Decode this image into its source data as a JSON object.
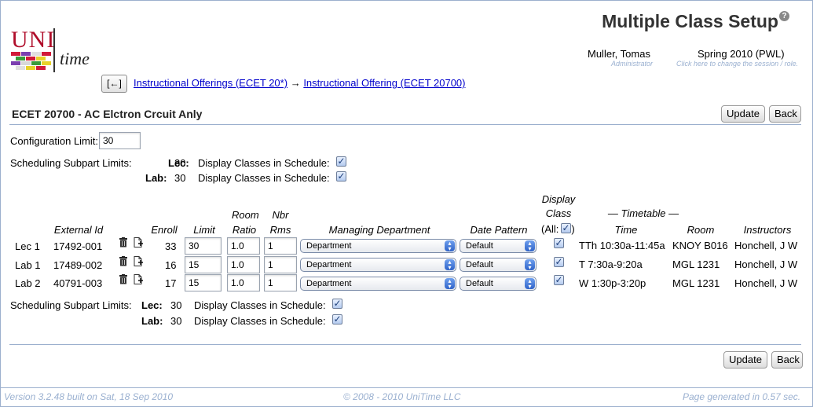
{
  "header": {
    "title": "Multiple Class Setup",
    "help": "?",
    "logo_uni": "UNI",
    "logo_time": "time",
    "user_name": "Muller, Tomas",
    "user_role": "Administrator",
    "session": "Spring 2010 (PWL)",
    "session_hint": "Click here to change the session / role."
  },
  "nav": {
    "back_label": "[←]",
    "crumb1": "Instructional Offerings (ECET 20*)",
    "arrow": "→",
    "crumb2": "Instructional Offering (ECET 20700)"
  },
  "section": {
    "title": "ECET 20700 - AC Elctron Crcuit Anly",
    "update_label": "Update",
    "back_label": "Back"
  },
  "config": {
    "label": "Configuration Limit:",
    "value": "30"
  },
  "subpart_limits": {
    "label": "Scheduling Subpart Limits:",
    "display_label": "Display Classes in Schedule:",
    "rows": [
      {
        "type": "Lec:",
        "limit": "30",
        "display": true
      },
      {
        "type": "Lab:",
        "limit": "30",
        "display": true
      }
    ]
  },
  "table": {
    "columns": {
      "external_id": "External Id",
      "enroll": "Enroll",
      "limit": "Limit",
      "room_ratio_1": "Room",
      "room_ratio_2": "Ratio",
      "nbr_rms_1": "Nbr",
      "nbr_rms_2": "Rms",
      "managing_dept": "Managing Department",
      "date_pattern": "Date Pattern",
      "display_1": "Display",
      "display_2": "Class",
      "display_all_open": "(All:",
      "display_all_close": ")",
      "timetable": "— Timetable —",
      "time": "Time",
      "room": "Room",
      "instructors": "Instructors"
    },
    "rows": [
      {
        "name": "Lec 1",
        "external_id": "17492-001",
        "enroll": "33",
        "limit": "30",
        "ratio": "1.0",
        "rooms": "1",
        "dept": "Department",
        "pattern": "Default",
        "display": true,
        "time": "TTh 10:30a-11:45a",
        "room": "KNOY B016",
        "instructor": "Honchell, J W"
      },
      {
        "name": "Lab 1",
        "external_id": "17489-002",
        "enroll": "16",
        "limit": "15",
        "ratio": "1.0",
        "rooms": "1",
        "dept": "Department",
        "pattern": "Default",
        "display": true,
        "time": "T 7:30a-9:20a",
        "room": "MGL 1231",
        "instructor": "Honchell, J W"
      },
      {
        "name": "Lab 2",
        "external_id": "40791-003",
        "enroll": "17",
        "limit": "15",
        "ratio": "1.0",
        "rooms": "1",
        "dept": "Department",
        "pattern": "Default",
        "display": true,
        "time": "W 1:30p-3:20p",
        "room": "MGL 1231",
        "instructor": "Honchell, J W"
      }
    ]
  },
  "footer": {
    "version": "Version 3.2.48 built on Sat, 18 Sep 2010",
    "copyright": "© 2008 - 2010 UniTime LLC",
    "generated": "Page generated in 0.57 sec."
  },
  "colors": {
    "link": "#0000cc",
    "rule": "#9cb0ce",
    "muted": "#9ab0d0",
    "logo_red": "#b00d2a"
  }
}
